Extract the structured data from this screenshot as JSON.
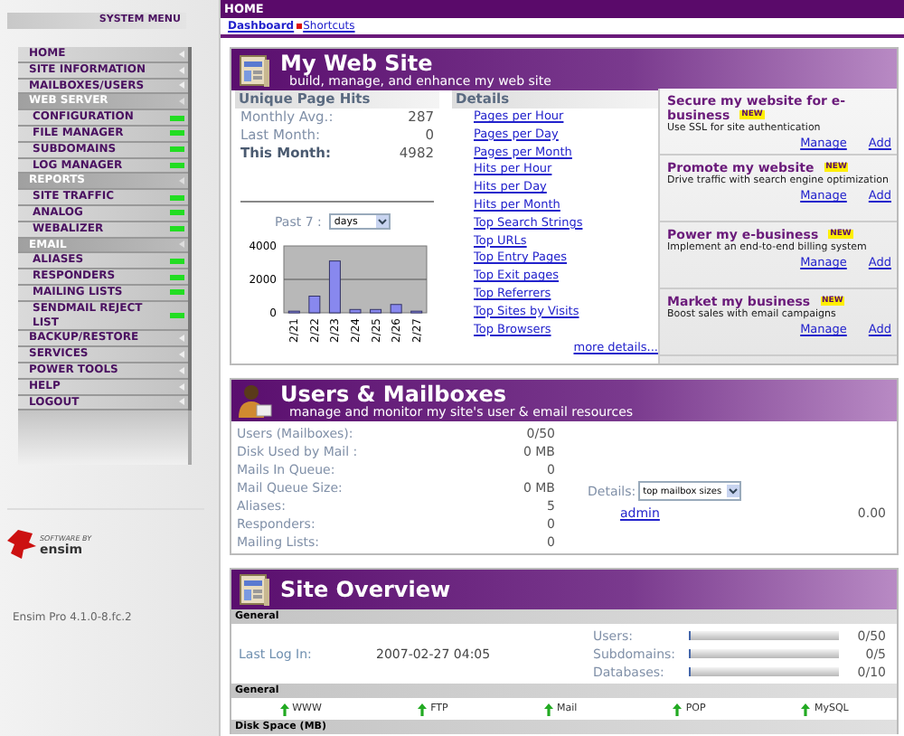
{
  "sidebar": {
    "title": "SYSTEM MENU",
    "items": [
      {
        "label": "HOME",
        "kind": "section"
      },
      {
        "label": "SITE INFORMATION",
        "kind": "section"
      },
      {
        "label": "MAILBOXES/USERS",
        "kind": "section"
      },
      {
        "label": "WEB SERVER",
        "kind": "group"
      },
      {
        "label": "CONFIGURATION",
        "kind": "page"
      },
      {
        "label": "FILE MANAGER",
        "kind": "page"
      },
      {
        "label": "SUBDOMAINS",
        "kind": "page"
      },
      {
        "label": "LOG MANAGER",
        "kind": "page"
      },
      {
        "label": "REPORTS",
        "kind": "group"
      },
      {
        "label": "SITE TRAFFIC",
        "kind": "page"
      },
      {
        "label": "ANALOG",
        "kind": "page"
      },
      {
        "label": "WEBALIZER",
        "kind": "page"
      },
      {
        "label": "EMAIL",
        "kind": "group"
      },
      {
        "label": "ALIASES",
        "kind": "page"
      },
      {
        "label": "RESPONDERS",
        "kind": "page"
      },
      {
        "label": "MAILING LISTS",
        "kind": "page"
      },
      {
        "label": "SENDMAIL REJECT LIST",
        "kind": "page"
      },
      {
        "label": "BACKUP/RESTORE",
        "kind": "section"
      },
      {
        "label": "SERVICES",
        "kind": "section"
      },
      {
        "label": "POWER TOOLS",
        "kind": "section"
      },
      {
        "label": "HELP",
        "kind": "section"
      },
      {
        "label": "LOGOUT",
        "kind": "section"
      }
    ],
    "logo_caption": "SOFTWARE BY",
    "logo_name": "ensim",
    "version": "Ensim Pro 4.1.0-8.fc.2"
  },
  "topbar": {
    "title": "HOME",
    "breadcrumb": [
      "Dashboard",
      "Shortcuts"
    ]
  },
  "web_site": {
    "title": "My Web Site",
    "subtitle": "build, manage, and enhance my web site",
    "hits": {
      "title": "Unique Page Hits",
      "rows": [
        {
          "label": "Monthly Avg.:",
          "value": "287",
          "bold": false
        },
        {
          "label": "Last Month:",
          "value": "0",
          "bold": false
        },
        {
          "label": "This Month:",
          "value": "4982",
          "bold": true
        }
      ]
    },
    "period_label": "Past 7 :",
    "period": "days",
    "chart_data": {
      "type": "bar",
      "categories": [
        "2/21",
        "2/22",
        "2/23",
        "2/24",
        "2/25",
        "2/26",
        "2/27"
      ],
      "values": [
        100,
        1000,
        3100,
        200,
        200,
        500,
        100
      ],
      "ylim": [
        0,
        4000
      ],
      "yticks": [
        0,
        2000,
        4000
      ]
    },
    "details_title": "Details",
    "details": [
      "Pages per Hour",
      "Pages per Day",
      "Pages per Month",
      "Hits per Hour",
      "Hits per Day",
      "Hits per Month",
      "Top Search Strings",
      "Top URLs",
      "Top Entry Pages",
      "Top Exit pages",
      "Top Referrers",
      "Top Sites by Visits",
      "Top Browsers"
    ],
    "more": "more details...",
    "promos": [
      {
        "title": "Secure my website for e-business",
        "badge": "NEW",
        "text": "Use SSL for site authentication",
        "links": [
          "Manage",
          "Add"
        ]
      },
      {
        "title": "Promote my website",
        "badge": "NEW",
        "text": "Drive traffic with search engine optimization",
        "links": [
          "Manage",
          "Add"
        ]
      },
      {
        "title": "Power my e-business",
        "badge": "NEW",
        "text": "Implement an end-to-end billing system",
        "links": [
          "Manage",
          "Add"
        ]
      },
      {
        "title": "Market my business",
        "badge": "NEW",
        "text": "Boost sales with email campaigns",
        "links": [
          "Manage",
          "Add"
        ]
      }
    ]
  },
  "users": {
    "title": "Users & Mailboxes",
    "subtitle": "manage and monitor my site's user & email resources",
    "rows": [
      {
        "label": "Users (Mailboxes):",
        "value": "0/50"
      },
      {
        "label": "Disk Used by Mail :",
        "value": "0 MB"
      },
      {
        "label": "Mails In Queue:",
        "value": "0"
      },
      {
        "label": "Mail Queue Size:",
        "value": "0 MB"
      },
      {
        "label": "Aliases:",
        "value": "5"
      },
      {
        "label": "Responders:",
        "value": "0"
      },
      {
        "label": "Mailing Lists:",
        "value": "0"
      }
    ],
    "details_label": "Details:",
    "details_choice": "top mailbox sizes",
    "mailboxes": [
      {
        "name": "admin",
        "size": "0.00"
      }
    ]
  },
  "overview": {
    "title": "Site Overview",
    "general_title": "General",
    "last_login_label": "Last Log In:",
    "last_login": "2007-02-27 04:05",
    "usage": [
      {
        "label": "Users:",
        "level": 0,
        "value": "0/50"
      },
      {
        "label": "Subdomains:",
        "level": 0,
        "value": "0/5"
      },
      {
        "label": "Databases:",
        "level": 0,
        "value": "0/10"
      }
    ],
    "services_title": "General",
    "services": [
      {
        "name": "WWW",
        "up": true
      },
      {
        "name": "FTP",
        "up": true
      },
      {
        "name": "Mail",
        "up": true
      },
      {
        "name": "POP",
        "up": true
      },
      {
        "name": "MySQL",
        "up": true
      }
    ],
    "disk_title": "Disk Space (MB)"
  }
}
